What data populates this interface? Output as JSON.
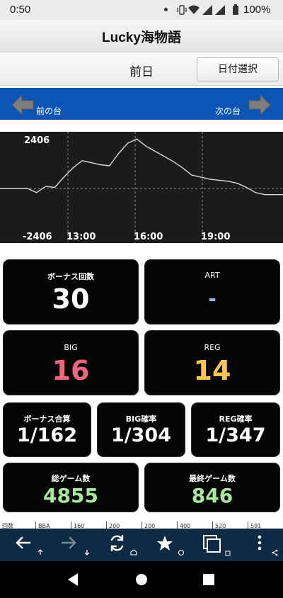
{
  "status_bar": {
    "time": "0:50",
    "battery": "100%"
  },
  "header": {
    "title": "Lucky海物語"
  },
  "day_bar": {
    "label": "前日",
    "date_button": "日付選択"
  },
  "nav_bar": {
    "prev_label": "前の台",
    "next_label": "次の台"
  },
  "chart_data": {
    "type": "line",
    "y_tick_labels": [
      "2406",
      "-2406"
    ],
    "ylim": [
      -2406,
      2406
    ],
    "x_tick_labels": [
      "13:00",
      "16:00",
      "19:00"
    ],
    "grid": true,
    "series": [
      {
        "color": "#d8d8d8",
        "values": [
          0,
          0,
          0,
          0,
          -200,
          100,
          50,
          550,
          1000,
          1350,
          1250,
          1150,
          1100,
          1700,
          2200,
          2400,
          2050,
          1800,
          1550,
          1300,
          1000,
          650,
          550,
          450,
          400,
          350,
          250,
          50,
          -200,
          -300,
          -300,
          -300
        ]
      }
    ]
  },
  "stats": {
    "bonus_count": {
      "label": "ボーナス回数",
      "value": "30"
    },
    "art": {
      "label": "ART",
      "value": "-"
    },
    "big": {
      "label": "BIG",
      "value": "16"
    },
    "reg": {
      "label": "REG",
      "value": "14"
    },
    "bonus_total": {
      "label": "ボーナス合算",
      "value": "1/162"
    },
    "big_rate": {
      "label": "BIG確率",
      "value": "1/304"
    },
    "reg_rate": {
      "label": "REG確率",
      "value": "1/347"
    },
    "total_games": {
      "label": "総ゲーム数",
      "value": "4855"
    },
    "last_games": {
      "label": "最終ゲーム数",
      "value": "846"
    }
  },
  "colors": {
    "big": "#f0657e",
    "reg": "#f5c653",
    "games": "#a8e89a",
    "art": "#8ab8ee",
    "nav_blue": "#0c55b4",
    "toolbar": "#0e2a44"
  },
  "table_strip": {
    "cells": [
      "回数",
      "BBA",
      "160",
      "200",
      "200",
      "400",
      "520",
      "591"
    ]
  },
  "toolbar": {
    "back": "back-arrow-icon",
    "forward": "forward-arrow-icon",
    "reload": "reload-icon",
    "bookmark": "star-icon",
    "tabs": "tabs-icon",
    "menu": "more-vert-icon"
  }
}
